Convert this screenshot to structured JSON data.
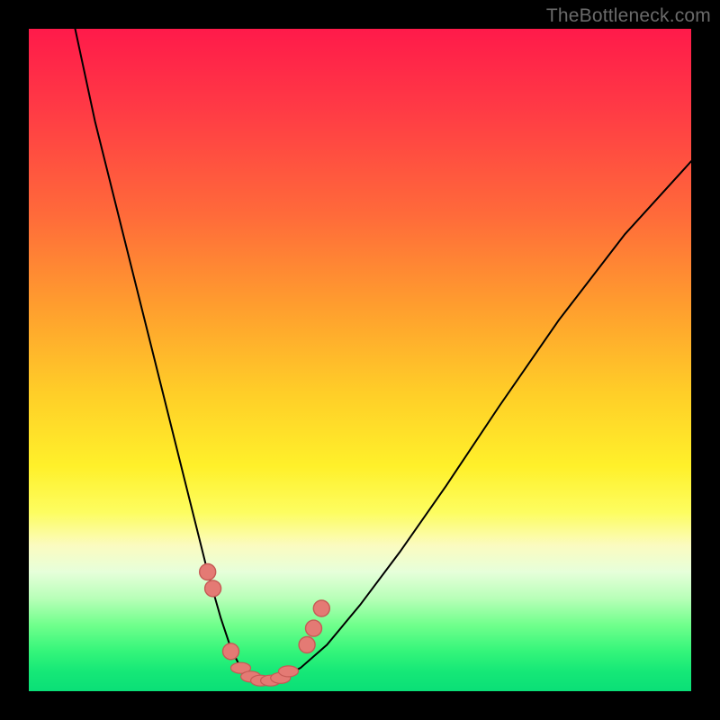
{
  "watermark": "TheBottleneck.com",
  "chart_data": {
    "type": "line",
    "title": "",
    "xlabel": "",
    "ylabel": "",
    "xlim": [
      0,
      100
    ],
    "ylim": [
      0,
      100
    ],
    "grid": false,
    "legend": false,
    "description": "Bottleneck-percentage valley curve. Background is a vertical red→yellow→green gradient (0% bottleneck at bottom = green, 100% at top = red). Black curve descends steeply from top-left, reaches a flat minimum near the bottom, then rises toward the right. Salmon markers highlight the sweet-spot region around the minimum.",
    "series": [
      {
        "name": "bottleneck-curve",
        "x": [
          7,
          10,
          14,
          18,
          22,
          25,
          27,
          29,
          30.5,
          32,
          34,
          36,
          38,
          41,
          45,
          50,
          56,
          63,
          71,
          80,
          90,
          100
        ],
        "y": [
          100,
          86,
          70,
          54,
          38,
          26,
          18,
          11,
          6.5,
          3.5,
          2,
          1.5,
          2,
          3.5,
          7,
          13,
          21,
          31,
          43,
          56,
          69,
          80
        ]
      }
    ],
    "markers": [
      {
        "x": 27.0,
        "y": 18.0
      },
      {
        "x": 27.8,
        "y": 15.5
      },
      {
        "x": 30.5,
        "y": 6.0
      },
      {
        "x": 32.0,
        "y": 3.5
      },
      {
        "x": 33.5,
        "y": 2.2
      },
      {
        "x": 35.0,
        "y": 1.6
      },
      {
        "x": 36.5,
        "y": 1.6
      },
      {
        "x": 38.0,
        "y": 2.0
      },
      {
        "x": 39.2,
        "y": 3.0
      },
      {
        "x": 42.0,
        "y": 7.0
      },
      {
        "x": 43.0,
        "y": 9.5
      },
      {
        "x": 44.2,
        "y": 12.5
      }
    ]
  }
}
